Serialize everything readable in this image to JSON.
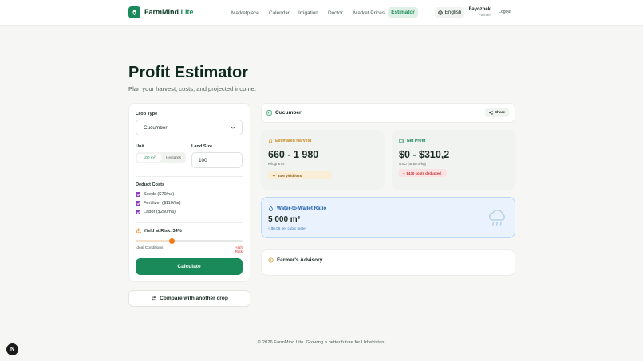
{
  "header": {
    "logo_name": "FarmMind",
    "logo_suffix": "Lite",
    "nav": [
      "Marketplace",
      "Calendar",
      "Irrigation",
      "Doctor",
      "Market Prices"
    ],
    "nav_active": "Estimator",
    "language": "English",
    "user_name": "Fayozbek",
    "user_role": "Farmer",
    "logout": "Logout"
  },
  "page": {
    "title": "Profit Estimator",
    "subtitle": "Plan your harvest, costs, and projected income."
  },
  "form": {
    "crop_type_label": "Crop Type",
    "crop_type_value": "Cucumber",
    "unit_label": "Unit",
    "unit_options": [
      "100 m²",
      "Hectares"
    ],
    "unit_selected": "100 m²",
    "land_size_label": "Land Size",
    "land_size_value": "100",
    "deduct_costs_label": "Deduct Costs",
    "costs": [
      {
        "label": "Seeds ($70/ha)",
        "checked": true
      },
      {
        "label": "Fertilizer ($110/ha)",
        "checked": true
      },
      {
        "label": "Labor ($250/ha)",
        "checked": true
      }
    ],
    "yield_risk_label": "Yield at Risk: 34%",
    "yield_risk_value": 0.34,
    "ideal_label": "Ideal Conditions",
    "high_risk_label": "High Risk",
    "calculate_label": "Calculate",
    "compare_label": "Compare with another crop"
  },
  "result": {
    "crop_name": "Cucumber",
    "share_label": "Share",
    "harvest": {
      "label": "Estimated Harvest",
      "value": "660 - 1 980",
      "unit": "Kilograms",
      "badge": "34% yield loss"
    },
    "profit": {
      "label": "Net Profit",
      "value": "$0 - $310,2",
      "unit": "USD (at $0.5/kg)",
      "badge": "$430 costs deducted"
    },
    "water": {
      "label": "Water-to-Wallet Ratio",
      "value": "5 000 m³",
      "sub": "≈ $0.06 per cubic meter"
    },
    "advisory_label": "Farmer's Advisory"
  },
  "footer": {
    "text": "© 2026 FarmMind Lite. Growing a better future for Uzbekistan.",
    "fab_label": "N"
  },
  "colors": {
    "brand": "#1b8a5a",
    "checkbox": "#8a3fb8",
    "risk_thumb": "#f07a14",
    "water_accent": "#1e5fa8"
  }
}
